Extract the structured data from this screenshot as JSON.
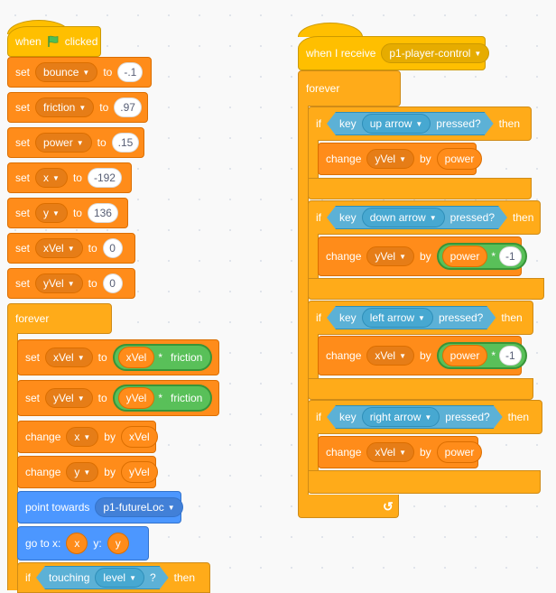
{
  "script_left": {
    "hat": {
      "when": "when",
      "clicked": "clicked",
      "flag_icon": "green-flag-icon"
    },
    "sets": [
      {
        "label": "set",
        "var": "bounce",
        "to": "to",
        "value": "-.1"
      },
      {
        "label": "set",
        "var": "friction",
        "to": "to",
        "value": ".97"
      },
      {
        "label": "set",
        "var": "power",
        "to": "to",
        "value": ".15"
      },
      {
        "label": "set",
        "var": "x",
        "to": "to",
        "value": "-192"
      },
      {
        "label": "set",
        "var": "y",
        "to": "to",
        "value": "136"
      },
      {
        "label": "set",
        "var": "xVel",
        "to": "to",
        "value": "0"
      },
      {
        "label": "set",
        "var": "yVel",
        "to": "to",
        "value": "0"
      }
    ],
    "forever": "forever",
    "inner": {
      "set_xvel": {
        "label": "set",
        "var": "xVel",
        "to": "to",
        "left": "xVel",
        "op": "*",
        "right": "friction"
      },
      "set_yvel": {
        "label": "set",
        "var": "yVel",
        "to": "to",
        "left": "yVel",
        "op": "*",
        "right": "friction"
      },
      "change_x": {
        "label": "change",
        "var": "x",
        "by": "by",
        "value": "xVel"
      },
      "change_y": {
        "label": "change",
        "var": "y",
        "by": "by",
        "value": "yVel"
      },
      "point": {
        "label": "point towards",
        "target": "p1-futureLoc"
      },
      "goto": {
        "label": "go to x:",
        "x": "x",
        "ylabel": "y:",
        "y": "y"
      },
      "if_touching": {
        "if": "if",
        "touching": "touching",
        "target": "level",
        "q": "?",
        "then": "then"
      }
    }
  },
  "script_right": {
    "hat": {
      "label": "when I receive",
      "message": "p1-player-control"
    },
    "forever": "forever",
    "ifs": [
      {
        "if": "if",
        "key": "key",
        "keyname": "up arrow",
        "pressed": "pressed?",
        "then": "then",
        "change": "change",
        "var": "yVel",
        "by": "by",
        "value": "power",
        "negate": false
      },
      {
        "if": "if",
        "key": "key",
        "keyname": "down arrow",
        "pressed": "pressed?",
        "then": "then",
        "change": "change",
        "var": "yVel",
        "by": "by",
        "value": "power",
        "op": "*",
        "factor": "-1",
        "negate": true
      },
      {
        "if": "if",
        "key": "key",
        "keyname": "left arrow",
        "pressed": "pressed?",
        "then": "then",
        "change": "change",
        "var": "xVel",
        "by": "by",
        "value": "power",
        "op": "*",
        "factor": "-1",
        "negate": true
      },
      {
        "if": "if",
        "key": "key",
        "keyname": "right arrow",
        "pressed": "pressed?",
        "then": "then",
        "change": "change",
        "var": "xVel",
        "by": "by",
        "value": "power",
        "negate": false
      }
    ],
    "loop_icon": "loop-arrow-icon",
    "loop_glyph": "↺"
  },
  "colors": {
    "events": "#ffbf00",
    "control": "#ffab19",
    "variables": "#ff8c1a",
    "sensing": "#5cb1d6",
    "motion": "#4c97ff",
    "operators": "#59c059"
  }
}
